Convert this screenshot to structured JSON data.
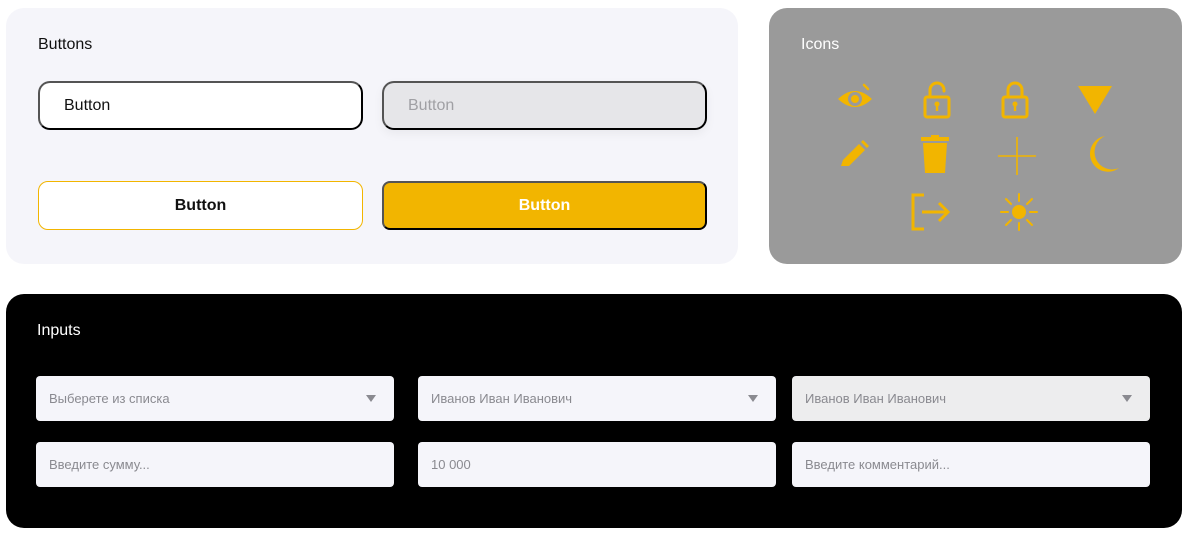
{
  "buttons_panel": {
    "title": "Buttons",
    "btn_white": "Button",
    "btn_gray": "Button",
    "btn_outline": "Button",
    "btn_filled": "Button"
  },
  "icons_panel": {
    "title": "Icons",
    "accent_color": "#F2B500",
    "icons": [
      "eye-off-icon",
      "lock-open-icon",
      "lock-icon",
      "triangle-down-icon",
      "pencil-icon",
      "trash-icon",
      "plus-icon",
      "moon-icon",
      "logout-icon",
      "sun-icon"
    ]
  },
  "inputs_panel": {
    "title": "Inputs",
    "select_1": {
      "placeholder": "Выберете из списка"
    },
    "select_2": {
      "value": "Иванов Иван Иванович"
    },
    "select_3": {
      "value": "Иванов Иван Иванович",
      "disabled": true
    },
    "amount": {
      "placeholder": "Введите сумму..."
    },
    "amount_filled": {
      "value": "10 000"
    },
    "comment": {
      "placeholder": "Введите комментарий..."
    }
  },
  "colors": {
    "accent": "#F2B500",
    "light_panel": "#F5F5FA",
    "icons_panel": "#9A9A9A",
    "dark_panel": "#000000"
  }
}
